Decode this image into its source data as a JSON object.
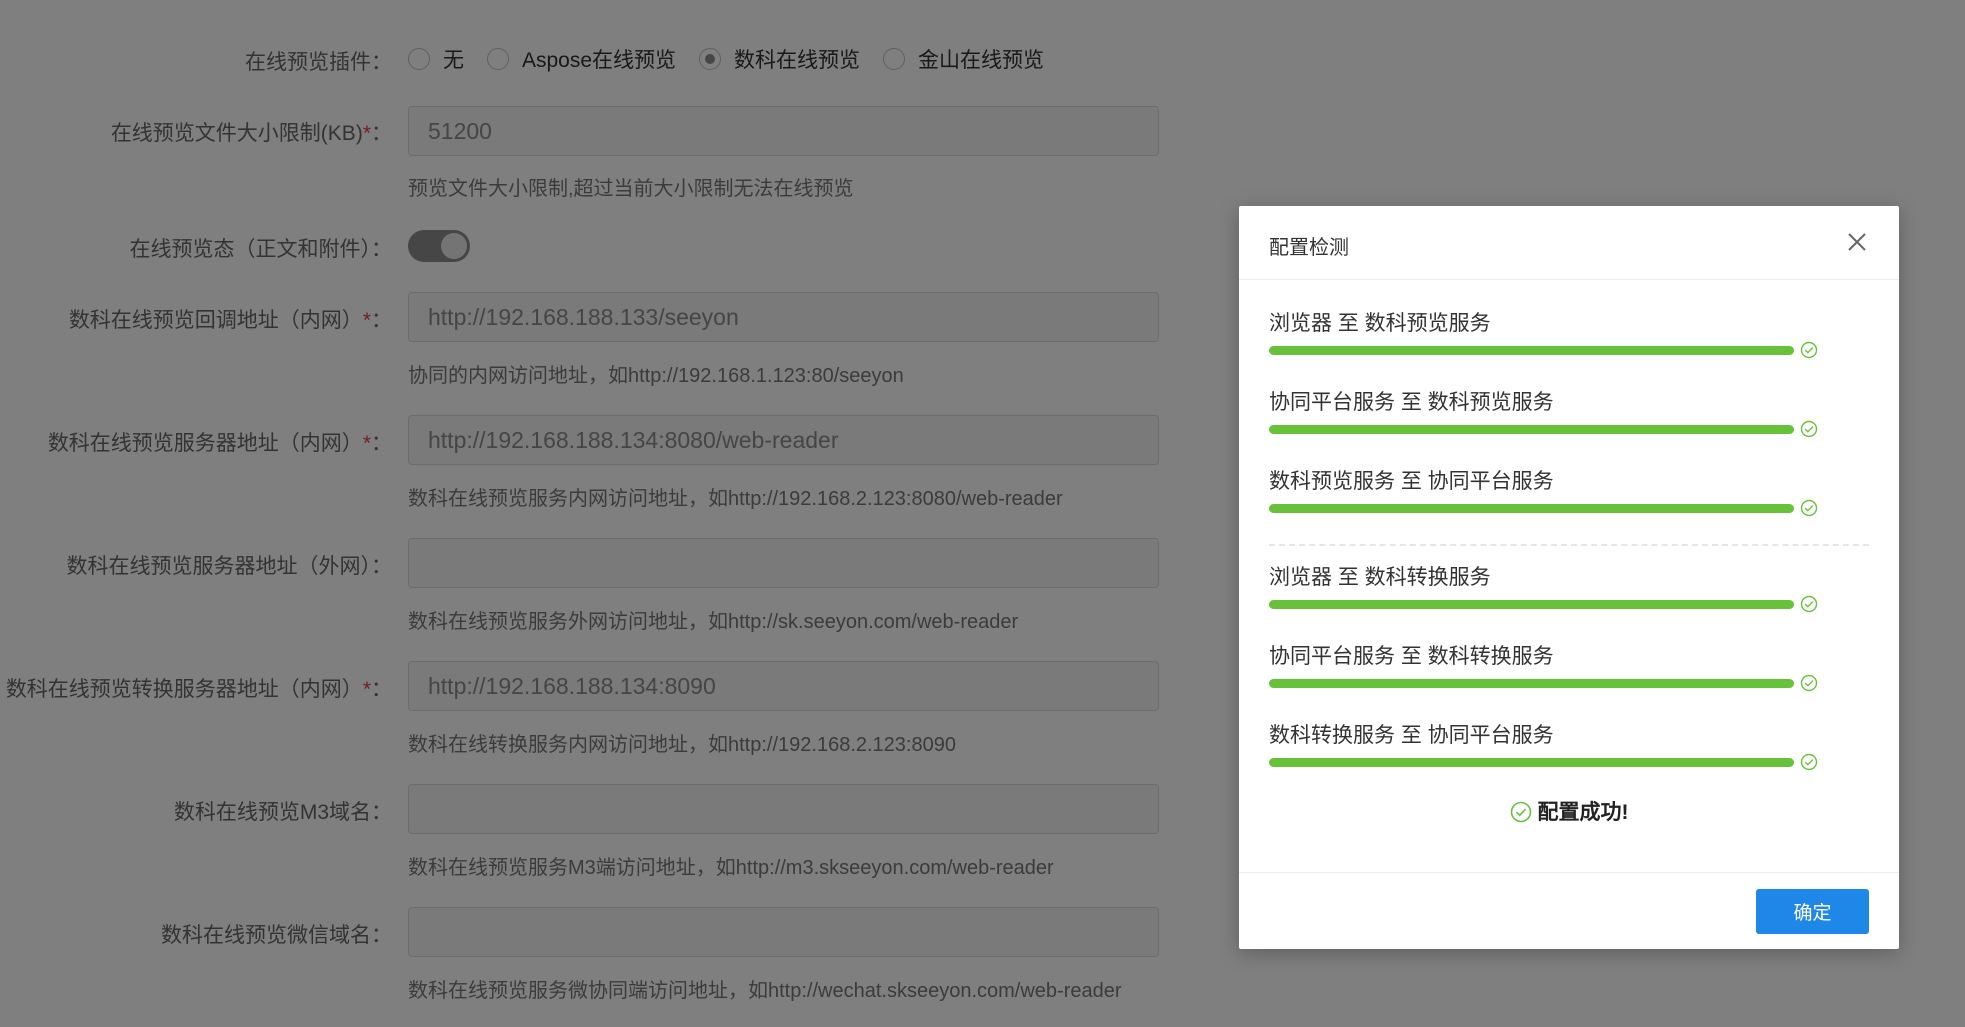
{
  "form": {
    "plugin_label": "在线预览插件：",
    "plugin_options": [
      {
        "label": "无",
        "checked": false
      },
      {
        "label": "Aspose在线预览",
        "checked": false
      },
      {
        "label": "数科在线预览",
        "checked": true
      },
      {
        "label": "金山在线预览",
        "checked": false
      }
    ],
    "size_limit": {
      "label": "在线预览文件大小限制(KB)",
      "required": "*",
      "suffix": "：",
      "value": "51200",
      "hint": "预览文件大小限制,超过当前大小限制无法在线预览"
    },
    "preview_state": {
      "label": "在线预览态（正文和附件）：",
      "on": true
    },
    "callback_url": {
      "label": "数科在线预览回调地址（内网）",
      "required": "*",
      "suffix": "：",
      "value": "http://192.168.188.133/seeyon",
      "hint": "协同的内网访问地址，如http://192.168.1.123:80/seeyon"
    },
    "server_url_internal": {
      "label": "数科在线预览服务器地址（内网）",
      "required": "*",
      "suffix": "：",
      "value": "http://192.168.188.134:8080/web-reader",
      "hint": "数科在线预览服务内网访问地址，如http://192.168.2.123:8080/web-reader"
    },
    "server_url_external": {
      "label": "数科在线预览服务器地址（外网）：",
      "value": "",
      "hint": "数科在线预览服务外网访问地址，如http://sk.seeyon.com/web-reader"
    },
    "convert_server_url": {
      "label": "数科在线预览转换服务器地址（内网）",
      "required": "*",
      "suffix": "：",
      "value": "http://192.168.188.134:8090",
      "hint": "数科在线转换服务内网访问地址，如http://192.168.2.123:8090"
    },
    "m3_domain": {
      "label": "数科在线预览M3域名：",
      "value": "",
      "hint": "数科在线预览服务M3端访问地址，如http://m3.skseeyon.com/web-reader"
    },
    "wechat_domain": {
      "label": "数科在线预览微信域名：",
      "value": "",
      "hint": "数科在线预览服务微协同端访问地址，如http://wechat.skseeyon.com/web-reader"
    }
  },
  "dialog": {
    "title": "配置检测",
    "checks": [
      {
        "label": "浏览器 至 数科预览服务",
        "progress": 1.0
      },
      {
        "label": "协同平台服务 至 数科预览服务",
        "progress": 1.0
      },
      {
        "label": "数科预览服务 至 协同平台服务",
        "progress": 1.0
      },
      {
        "label": "浏览器 至 数科转换服务",
        "progress": 1.0
      },
      {
        "label": "协同平台服务 至 数科转换服务",
        "progress": 1.0
      },
      {
        "label": "数科转换服务 至 协同平台服务",
        "progress": 1.0
      }
    ],
    "success_text": "配置成功!",
    "ok_label": "确定"
  },
  "colors": {
    "success": "#67c23a",
    "primary": "#1f87e8",
    "required": "#e83a3a"
  },
  "icons": {
    "close": "close-icon",
    "check": "check-circle-icon"
  }
}
